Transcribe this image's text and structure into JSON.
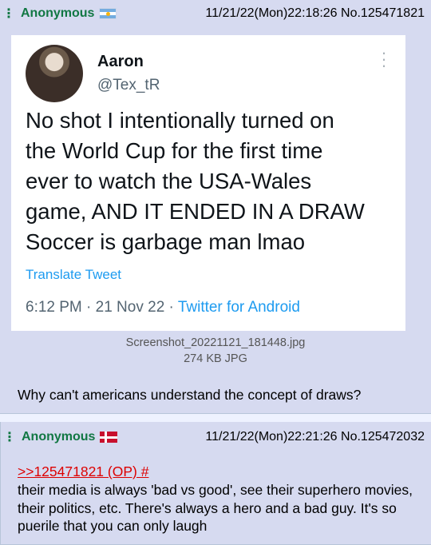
{
  "post1": {
    "name": "Anonymous",
    "flag": "argentina-flag",
    "datetime": "11/21/22(Mon)22:18:26",
    "number": "No.125471821",
    "tweet": {
      "author": "Aaron",
      "handle": "@Tex_tR",
      "text": "No shot I intentionally turned on\nthe World Cup for the first time\never to watch the USA-Wales\ngame, AND IT ENDED IN A DRAW\nSoccer is garbage man lmao",
      "translate": "Translate Tweet",
      "time": "6:12 PM · 21 Nov 22 · ",
      "source": "Twitter for Android"
    },
    "file_name": "Screenshot_20221121_181448.jpg",
    "file_size": "274 KB JPG",
    "comment": "Why can't americans understand the concept of draws?"
  },
  "post2": {
    "name": "Anonymous",
    "flag": "denmark-flag",
    "datetime": "11/21/22(Mon)22:21:26",
    "number": "No.125472032",
    "quote": ">>125471821 (OP) #",
    "text": "their media is always 'bad vs good', see their superhero movies, their politics, etc. There's always a hero and a bad guy. It's so puerile that you can only laugh"
  },
  "colors": {
    "name_green": "#117743",
    "post_bg": "#d6daf0",
    "quote_red": "#dd0000",
    "twitter_blue": "#1d9bf0"
  }
}
